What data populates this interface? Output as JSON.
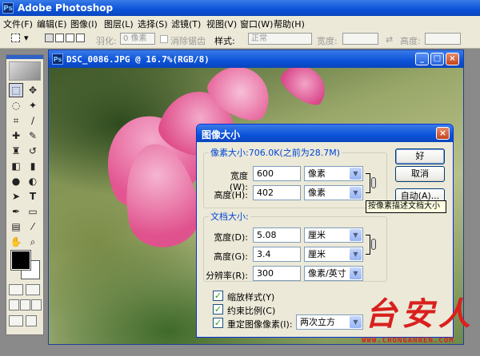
{
  "app": {
    "title": "Adobe Photoshop",
    "icon": "photoshop-logo-icon"
  },
  "menu": {
    "items": [
      {
        "label": "文件(F)"
      },
      {
        "label": "编辑(E)"
      },
      {
        "label": "图像(I)"
      },
      {
        "label": "图层(L)"
      },
      {
        "label": "选择(S)"
      },
      {
        "label": "滤镜(T)"
      },
      {
        "label": "视图(V)"
      },
      {
        "label": "窗口(W)"
      },
      {
        "label": "帮助(H)"
      }
    ]
  },
  "options": {
    "feather_label": "羽化:",
    "feather_value": "0 像素",
    "antialias_label": "消除锯齿",
    "style_label": "样式:",
    "style_value": "正常",
    "width_label": "宽度:",
    "height_label": "高度:"
  },
  "document": {
    "title": "DSC_0086.JPG @ 16.7%(RGB/8)",
    "colors": {
      "petal": "#e35591",
      "petal_light": "#f29cc0"
    }
  },
  "dialog": {
    "title": "图像大小",
    "pixel_group_label": "像素大小:706.0K(之前为28.7M)",
    "pixel_width_label": "宽度(W):",
    "pixel_width_value": "600",
    "pixel_width_unit": "像素",
    "pixel_height_label": "高度(H):",
    "pixel_height_value": "402",
    "pixel_height_unit": "像素",
    "doc_group_label": "文档大小:",
    "doc_width_label": "宽度(D):",
    "doc_width_value": "5.08",
    "doc_width_unit": "厘米",
    "doc_height_label": "高度(G):",
    "doc_height_value": "3.4",
    "doc_height_unit": "厘米",
    "resolution_label": "分辨率(R):",
    "resolution_value": "300",
    "resolution_unit": "像素/英寸",
    "scale_styles_label": "缩放样式(Y)",
    "constrain_label": "约束比例(C)",
    "resample_label": "重定图像像素(I):",
    "resample_method": "两次立方",
    "ok_label": "好",
    "cancel_label": "取消",
    "auto_label": "自动(A)...",
    "tooltip": "按像素描述文档大小"
  },
  "watermark": {
    "text": "台安人",
    "url": "WWW.CHONGANREN.COM"
  }
}
